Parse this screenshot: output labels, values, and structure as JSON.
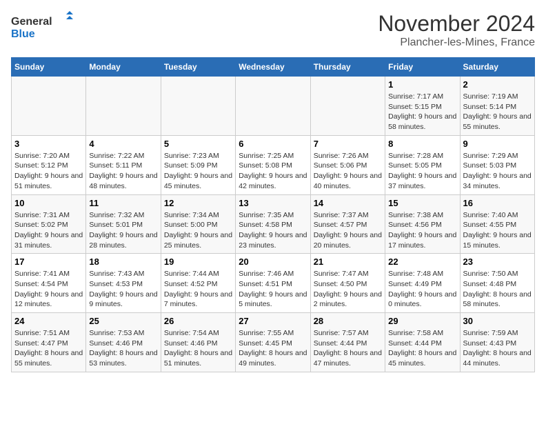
{
  "logo": {
    "line1": "General",
    "line2": "Blue"
  },
  "title": "November 2024",
  "location": "Plancher-les-Mines, France",
  "weekdays": [
    "Sunday",
    "Monday",
    "Tuesday",
    "Wednesday",
    "Thursday",
    "Friday",
    "Saturday"
  ],
  "weeks": [
    [
      {
        "day": "",
        "info": ""
      },
      {
        "day": "",
        "info": ""
      },
      {
        "day": "",
        "info": ""
      },
      {
        "day": "",
        "info": ""
      },
      {
        "day": "",
        "info": ""
      },
      {
        "day": "1",
        "info": "Sunrise: 7:17 AM\nSunset: 5:15 PM\nDaylight: 9 hours and 58 minutes."
      },
      {
        "day": "2",
        "info": "Sunrise: 7:19 AM\nSunset: 5:14 PM\nDaylight: 9 hours and 55 minutes."
      }
    ],
    [
      {
        "day": "3",
        "info": "Sunrise: 7:20 AM\nSunset: 5:12 PM\nDaylight: 9 hours and 51 minutes."
      },
      {
        "day": "4",
        "info": "Sunrise: 7:22 AM\nSunset: 5:11 PM\nDaylight: 9 hours and 48 minutes."
      },
      {
        "day": "5",
        "info": "Sunrise: 7:23 AM\nSunset: 5:09 PM\nDaylight: 9 hours and 45 minutes."
      },
      {
        "day": "6",
        "info": "Sunrise: 7:25 AM\nSunset: 5:08 PM\nDaylight: 9 hours and 42 minutes."
      },
      {
        "day": "7",
        "info": "Sunrise: 7:26 AM\nSunset: 5:06 PM\nDaylight: 9 hours and 40 minutes."
      },
      {
        "day": "8",
        "info": "Sunrise: 7:28 AM\nSunset: 5:05 PM\nDaylight: 9 hours and 37 minutes."
      },
      {
        "day": "9",
        "info": "Sunrise: 7:29 AM\nSunset: 5:03 PM\nDaylight: 9 hours and 34 minutes."
      }
    ],
    [
      {
        "day": "10",
        "info": "Sunrise: 7:31 AM\nSunset: 5:02 PM\nDaylight: 9 hours and 31 minutes."
      },
      {
        "day": "11",
        "info": "Sunrise: 7:32 AM\nSunset: 5:01 PM\nDaylight: 9 hours and 28 minutes."
      },
      {
        "day": "12",
        "info": "Sunrise: 7:34 AM\nSunset: 5:00 PM\nDaylight: 9 hours and 25 minutes."
      },
      {
        "day": "13",
        "info": "Sunrise: 7:35 AM\nSunset: 4:58 PM\nDaylight: 9 hours and 23 minutes."
      },
      {
        "day": "14",
        "info": "Sunrise: 7:37 AM\nSunset: 4:57 PM\nDaylight: 9 hours and 20 minutes."
      },
      {
        "day": "15",
        "info": "Sunrise: 7:38 AM\nSunset: 4:56 PM\nDaylight: 9 hours and 17 minutes."
      },
      {
        "day": "16",
        "info": "Sunrise: 7:40 AM\nSunset: 4:55 PM\nDaylight: 9 hours and 15 minutes."
      }
    ],
    [
      {
        "day": "17",
        "info": "Sunrise: 7:41 AM\nSunset: 4:54 PM\nDaylight: 9 hours and 12 minutes."
      },
      {
        "day": "18",
        "info": "Sunrise: 7:43 AM\nSunset: 4:53 PM\nDaylight: 9 hours and 9 minutes."
      },
      {
        "day": "19",
        "info": "Sunrise: 7:44 AM\nSunset: 4:52 PM\nDaylight: 9 hours and 7 minutes."
      },
      {
        "day": "20",
        "info": "Sunrise: 7:46 AM\nSunset: 4:51 PM\nDaylight: 9 hours and 5 minutes."
      },
      {
        "day": "21",
        "info": "Sunrise: 7:47 AM\nSunset: 4:50 PM\nDaylight: 9 hours and 2 minutes."
      },
      {
        "day": "22",
        "info": "Sunrise: 7:48 AM\nSunset: 4:49 PM\nDaylight: 9 hours and 0 minutes."
      },
      {
        "day": "23",
        "info": "Sunrise: 7:50 AM\nSunset: 4:48 PM\nDaylight: 8 hours and 58 minutes."
      }
    ],
    [
      {
        "day": "24",
        "info": "Sunrise: 7:51 AM\nSunset: 4:47 PM\nDaylight: 8 hours and 55 minutes."
      },
      {
        "day": "25",
        "info": "Sunrise: 7:53 AM\nSunset: 4:46 PM\nDaylight: 8 hours and 53 minutes."
      },
      {
        "day": "26",
        "info": "Sunrise: 7:54 AM\nSunset: 4:46 PM\nDaylight: 8 hours and 51 minutes."
      },
      {
        "day": "27",
        "info": "Sunrise: 7:55 AM\nSunset: 4:45 PM\nDaylight: 8 hours and 49 minutes."
      },
      {
        "day": "28",
        "info": "Sunrise: 7:57 AM\nSunset: 4:44 PM\nDaylight: 8 hours and 47 minutes."
      },
      {
        "day": "29",
        "info": "Sunrise: 7:58 AM\nSunset: 4:44 PM\nDaylight: 8 hours and 45 minutes."
      },
      {
        "day": "30",
        "info": "Sunrise: 7:59 AM\nSunset: 4:43 PM\nDaylight: 8 hours and 44 minutes."
      }
    ]
  ]
}
